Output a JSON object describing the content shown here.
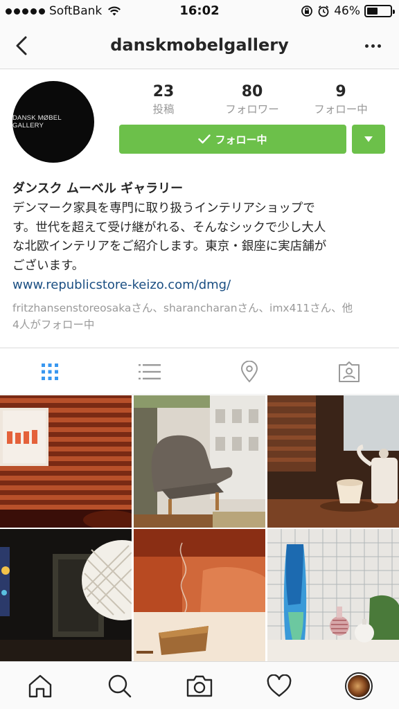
{
  "status_bar": {
    "carrier": "SoftBank",
    "time": "16:02",
    "battery": "46%",
    "battery_level": 0.46,
    "icons": [
      "signal-dots",
      "wifi-icon",
      "rotation-lock-icon",
      "alarm-icon",
      "battery-icon"
    ]
  },
  "nav": {
    "title": "danskmobelgallery",
    "icons": [
      "back-chevron-icon",
      "more-dots-icon"
    ]
  },
  "profile": {
    "avatar_text": "DANSK MØBEL GALLERY",
    "stats": [
      {
        "value": "23",
        "label": "投稿"
      },
      {
        "value": "80",
        "label": "フォロワー"
      },
      {
        "value": "9",
        "label": "フォロー中"
      }
    ],
    "follow_button": "フォロー中",
    "name": "ダンスク ムーベル ギャラリー",
    "bio_lines": [
      "デンマーク家具を専門に取り扱うインテリアショップで",
      "す。世代を超えて受け継がれる、そんなシックで少し大人",
      "な北欧インテリアをご紹介します。東京・銀座に実店舗が",
      "ございます。"
    ],
    "link": "www.republicstore-keizo.com/dmg/",
    "followed_by_lines": [
      "fritzhansenstoreosakaさん、sharancharanさん、imx411さん、他",
      "4人がフォロー中"
    ]
  },
  "tabs": [
    {
      "name": "grid-view",
      "icon": "grid-icon",
      "active": true
    },
    {
      "name": "list-view",
      "icon": "list-icon",
      "active": false
    },
    {
      "name": "map-view",
      "icon": "location-pin-icon",
      "active": false
    },
    {
      "name": "tagged-view",
      "icon": "tagged-person-icon",
      "active": false
    }
  ],
  "posts": [
    {
      "subject": "red wall panel with artwork"
    },
    {
      "subject": "grey papa bear armchair"
    },
    {
      "subject": "teapot and cup on table"
    },
    {
      "subject": "pendant lamp and dark room"
    },
    {
      "subject": "incense on wooden tray"
    },
    {
      "subject": "blue glass vase and bottles"
    }
  ],
  "tab_bar": {
    "items": [
      "home-icon",
      "search-icon",
      "camera-icon",
      "heart-icon",
      "profile-avatar"
    ]
  },
  "colors": {
    "follow_green": "#6cc04a",
    "link_blue": "#1a4e82",
    "active_tab_blue": "#3897f0",
    "muted_grey": "#999999"
  }
}
